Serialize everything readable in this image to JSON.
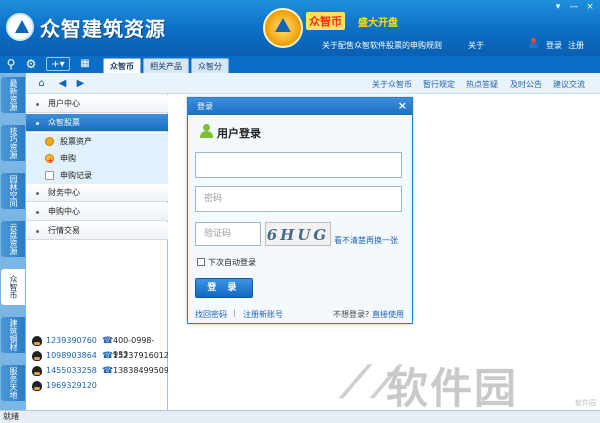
{
  "app": {
    "title": "众智建筑资源",
    "promo_title": "众智币",
    "promo_sub": "盛大开盘",
    "window_controls": [
      "▾",
      "—",
      "×"
    ]
  },
  "top_links": {
    "notice": "关于配售众智软件股票的申购规则",
    "about": "关于",
    "login": "登录",
    "register": "注册"
  },
  "toolbar": {
    "icons": [
      "search-icon",
      "gear-icon",
      "add-icon",
      "grid-icon"
    ],
    "tabs": [
      "众智币",
      "相关产品",
      "众智分"
    ]
  },
  "navbar": {
    "links": [
      "关于众智币",
      "暂行规定",
      "热点答疑",
      "及时公告",
      "建议交流"
    ]
  },
  "vertical_tabs": [
    "最新资源",
    "技巧资源",
    "园林空间",
    "云盘资源",
    "众智币",
    "建筑钢材",
    "服务天地"
  ],
  "left_menu": {
    "items": [
      {
        "label": "用户中心"
      },
      {
        "label": "众智股票"
      },
      {
        "label": "财务中心"
      },
      {
        "label": "申购中心"
      },
      {
        "label": "行情交易"
      }
    ],
    "sub_items": [
      {
        "label": "股票资产",
        "icon": "coin-icon"
      },
      {
        "label": "申购",
        "icon": "apply-icon"
      },
      {
        "label": "申购记录",
        "icon": "record-icon"
      }
    ]
  },
  "contacts": [
    {
      "qq": "1239390760",
      "phone": "400-0998-933"
    },
    {
      "qq": "1098903864",
      "phone": "15237916012"
    },
    {
      "qq": "1455033258",
      "phone": "13838499509"
    },
    {
      "qq": "1969329120",
      "phone": ""
    }
  ],
  "login_dialog": {
    "title": "登录",
    "close": "×",
    "heading": "用户登录",
    "username_value": "",
    "username_placeholder": "",
    "password_placeholder": "密码",
    "captcha_placeholder": "验证码",
    "captcha_text": "6HUG",
    "refresh_text": "看不清楚再换一张",
    "auto_login": "下次自动登录",
    "login_button": "登 录",
    "recover": "找回密码",
    "separator": "|",
    "register_new": "注册新账号",
    "no_account": "不想登录?",
    "direct_use": "直接使用"
  },
  "watermark": {
    "text": "软件园",
    "sub": "软件园"
  },
  "status": {
    "text": "就绪"
  },
  "colors": {
    "titlebar": "#0b6ec6",
    "accent": "#1d62b1",
    "menu_active": "#1a6ec1"
  }
}
